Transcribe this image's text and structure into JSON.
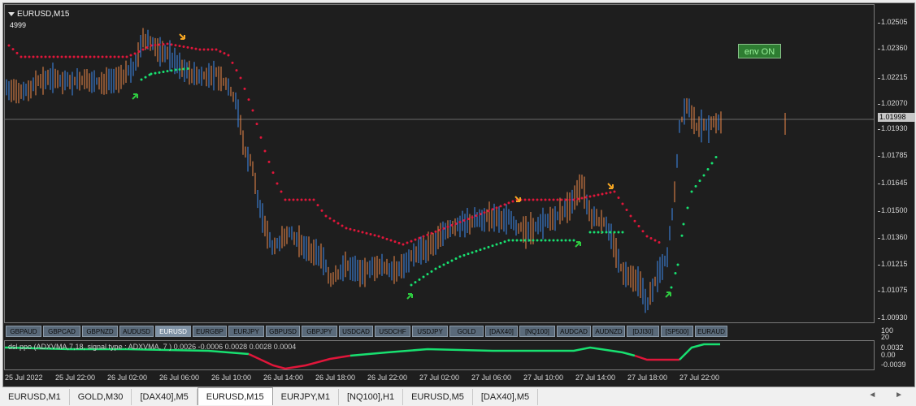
{
  "chart": {
    "symbol_title": "EURUSD,M15",
    "bar_count": "4999",
    "env_button": "env ON",
    "price_ticks": [
      "1.02505",
      "1.02360",
      "1.02215",
      "1.02070",
      "1.01930",
      "1.01785",
      "1.01645",
      "1.01500",
      "1.01360",
      "1.01215",
      "1.01075",
      "1.00930"
    ],
    "current_price": "1.01998",
    "time_ticks": [
      "25 Jul 2022",
      "25 Jul 22:00",
      "26 Jul 02:00",
      "26 Jul 06:00",
      "26 Jul 10:00",
      "26 Jul 14:00",
      "26 Jul 18:00",
      "26 Jul 22:00",
      "27 Jul 02:00",
      "27 Jul 06:00",
      "27 Jul 10:00",
      "27 Jul 14:00",
      "27 Jul 18:00",
      "27 Jul 22:00"
    ],
    "colors": {
      "bull": "#3f8cf0",
      "bear": "#f08a4a",
      "stop_down": "#e0163a",
      "stop_up": "#18e070",
      "arrow_up": "#2ecc40",
      "arrow_down": "#f5a623",
      "background": "#1e1e1e"
    }
  },
  "symbols": [
    "GBPAUD",
    "GBPCAD",
    "GBPNZD",
    "AUDUSD",
    "EURUSD",
    "EURGBP",
    "EURJPY",
    "GBPUSD",
    "GBPJPY",
    "USDCAD",
    "USDCHF",
    "USDJPY",
    "GOLD",
    "[DAX40]",
    "[NQ100]",
    "AUDCAD",
    "AUDNZD",
    "[DJI30]",
    "[SP500]",
    "EURAUD"
  ],
  "active_symbol": "EURUSD",
  "indicator": {
    "label": "dsl ppo (ADXVMA,7,18, signal type : ADXVMA, 7 ) 0.0026 -0.0006 0.0028 0.0028 0.0004",
    "scale_top": [
      "100",
      "20"
    ],
    "scale_ticks": [
      "0.0032",
      "0.00",
      "-0.0039"
    ]
  },
  "tabs": [
    "EURUSD,M1",
    "GOLD,M30",
    "[DAX40],M5",
    "EURUSD,M15",
    "EURJPY,M1",
    "[NQ100],H1",
    "EURUSD,M5",
    "[DAX40],M5"
  ],
  "active_tab": "EURUSD,M15",
  "tab_scroll": "◄ ►"
}
